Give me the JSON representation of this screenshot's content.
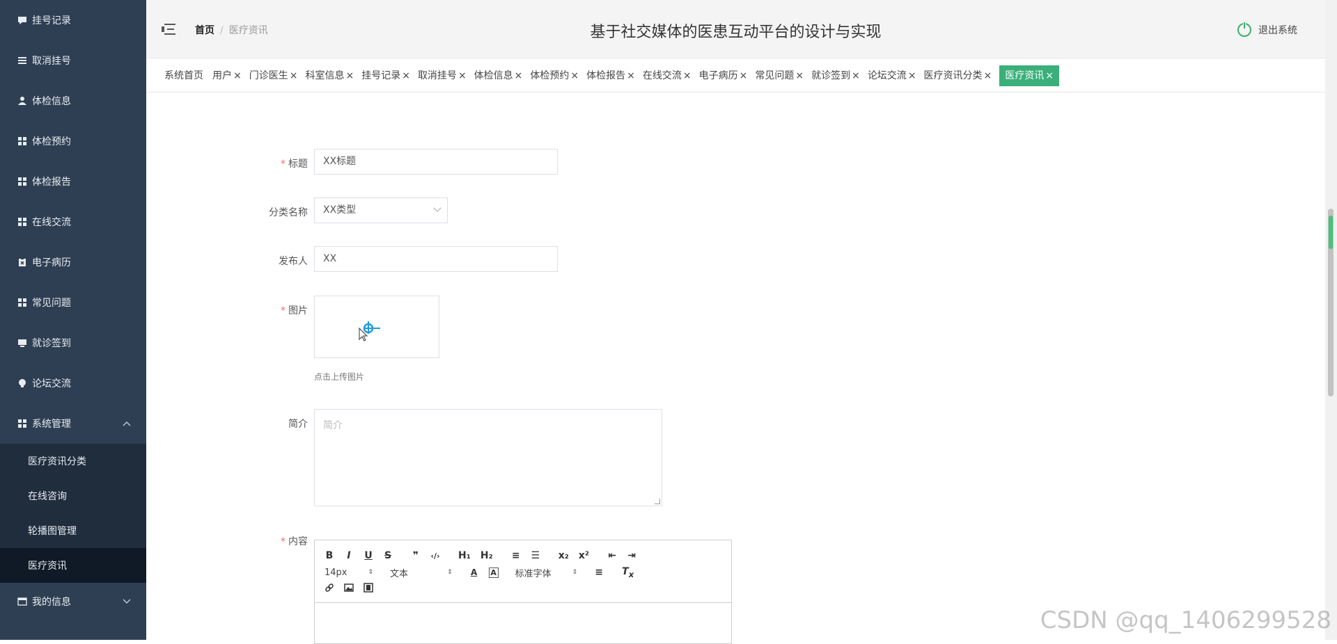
{
  "sidebar": {
    "items": [
      {
        "label": "挂号记录",
        "icon": "chat-icon"
      },
      {
        "label": "取消挂号",
        "icon": "list-icon"
      },
      {
        "label": "体检信息",
        "icon": "user-icon"
      },
      {
        "label": "体检预约",
        "icon": "grid-icon"
      },
      {
        "label": "体检报告",
        "icon": "grid-icon"
      },
      {
        "label": "在线交流",
        "icon": "grid-icon"
      },
      {
        "label": "电子病历",
        "icon": "clipboard-icon"
      },
      {
        "label": "常见问题",
        "icon": "grid-icon"
      },
      {
        "label": "就诊签到",
        "icon": "monitor-icon"
      },
      {
        "label": "论坛交流",
        "icon": "bulb-icon"
      }
    ],
    "system": {
      "label": "系统管理",
      "caret": "^"
    },
    "submenu": [
      "医疗资讯分类",
      "在线咨询",
      "轮播图管理",
      "医疗资讯"
    ],
    "active_submenu": "医疗资讯",
    "my_info": {
      "label": "我的信息",
      "caret": "v"
    }
  },
  "header": {
    "breadcrumb_home": "首页",
    "breadcrumb_sep": "/",
    "breadcrumb_current": "医疗资讯",
    "title": "基于社交媒体的医患互动平台的设计与实现",
    "logout": "退出系统"
  },
  "tabs": [
    {
      "label": "系统首页",
      "close": ""
    },
    {
      "label": "用户",
      "close": "×"
    },
    {
      "label": "门诊医生",
      "close": "×"
    },
    {
      "label": "科室信息",
      "close": "×"
    },
    {
      "label": "挂号记录",
      "close": "×"
    },
    {
      "label": "取消挂号",
      "close": "×"
    },
    {
      "label": "体检信息",
      "close": "×"
    },
    {
      "label": "体检预约",
      "close": "×"
    },
    {
      "label": "体检报告",
      "close": "×"
    },
    {
      "label": "在线交流",
      "close": "×"
    },
    {
      "label": "电子病历",
      "close": "×"
    },
    {
      "label": "常见问题",
      "close": "×"
    },
    {
      "label": "就诊签到",
      "close": "×"
    },
    {
      "label": "论坛交流",
      "close": "×"
    },
    {
      "label": "医疗资讯分类",
      "close": "×"
    },
    {
      "label": "医疗资讯",
      "close": "×"
    }
  ],
  "form": {
    "required_mark": "*",
    "title_label": "标题",
    "title_value": "XX标题",
    "category_label": "分类名称",
    "category_value": "XX类型",
    "publisher_label": "发布人",
    "publisher_value": "XX",
    "image_label": "图片",
    "upload_hint": "点击上传图片",
    "intro_label": "简介",
    "intro_placeholder": "简介",
    "content_label": "内容"
  },
  "editor": {
    "row1": [
      "B",
      "I",
      "U",
      "S",
      "❞",
      "‹/›",
      "H₁",
      "H₂",
      "≡",
      "☰",
      "x₂",
      "x²",
      "⇤",
      "⇥"
    ],
    "font_size": "14px",
    "block_type": "文本",
    "font_family": "标准字体",
    "updown": "⇕"
  },
  "watermark": "CSDN @qq_1406299528",
  "colors": {
    "sidebar": "#2f3f53",
    "accent": "#3aaf7a",
    "required": "#f56c6c"
  }
}
